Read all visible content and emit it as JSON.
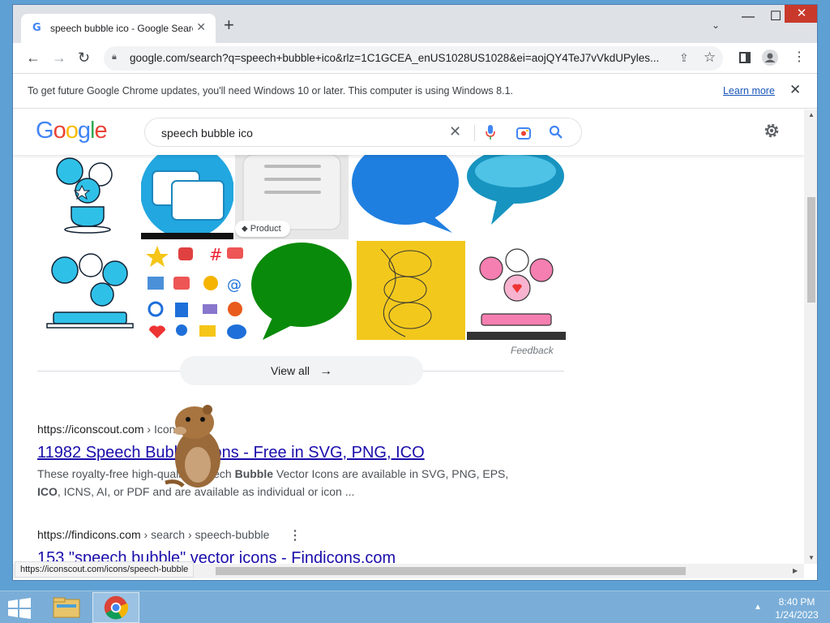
{
  "browser": {
    "tab_title": "speech bubble ico - Google Search",
    "new_tab": "+",
    "url": "google.com/search?q=speech+bubble+ico&rlz=1C1GCEA_enUS1028US1028&ei=aojQY4TeJ7vVkdUPyles...",
    "window_controls": {
      "minimize": "—",
      "maximize": "☐",
      "close": "✕"
    }
  },
  "infobar": {
    "message": "To get future Google Chrome updates, you'll need Windows 10 or later. This computer is using Windows 8.1.",
    "learn_more": "Learn more"
  },
  "google": {
    "logo": [
      "G",
      "o",
      "o",
      "g",
      "l",
      "e"
    ],
    "logo_colors": [
      "#4285f4",
      "#ea4335",
      "#fbbc05",
      "#4285f4",
      "#34a853",
      "#ea4335"
    ],
    "query": "speech bubble ico"
  },
  "images": {
    "product_chip": "Product",
    "feedback": "Feedback",
    "view_all": "View all"
  },
  "results": [
    {
      "site": "https://iconscout.com",
      "path": " › Icons",
      "title": "11982 Speech Bubble Icons - Free in SVG, PNG, ICO",
      "snippet_pre": "These royalty-free high-quality Speech ",
      "snippet_bold": "Bubble",
      "snippet_mid": " Vector Icons are available in SVG, PNG, EPS, ",
      "snippet_bold2": "ICO",
      "snippet_post": ", ICNS, AI, or PDF and are available as individual or icon ..."
    },
    {
      "site": "https://findicons.com",
      "path": " › search › speech-bubble",
      "title": "153 \"speech bubble\" vector icons - Findicons.com"
    }
  ],
  "status_url": "https://iconscout.com/icons/speech-bubble",
  "taskbar": {
    "time": "8:40 PM",
    "date": "1/24/2023"
  },
  "colors": {
    "link": "#1a0dab",
    "accent_blue": "#4285f4",
    "desktop": "#5fa0d4",
    "taskbar": "#7aaed8"
  }
}
